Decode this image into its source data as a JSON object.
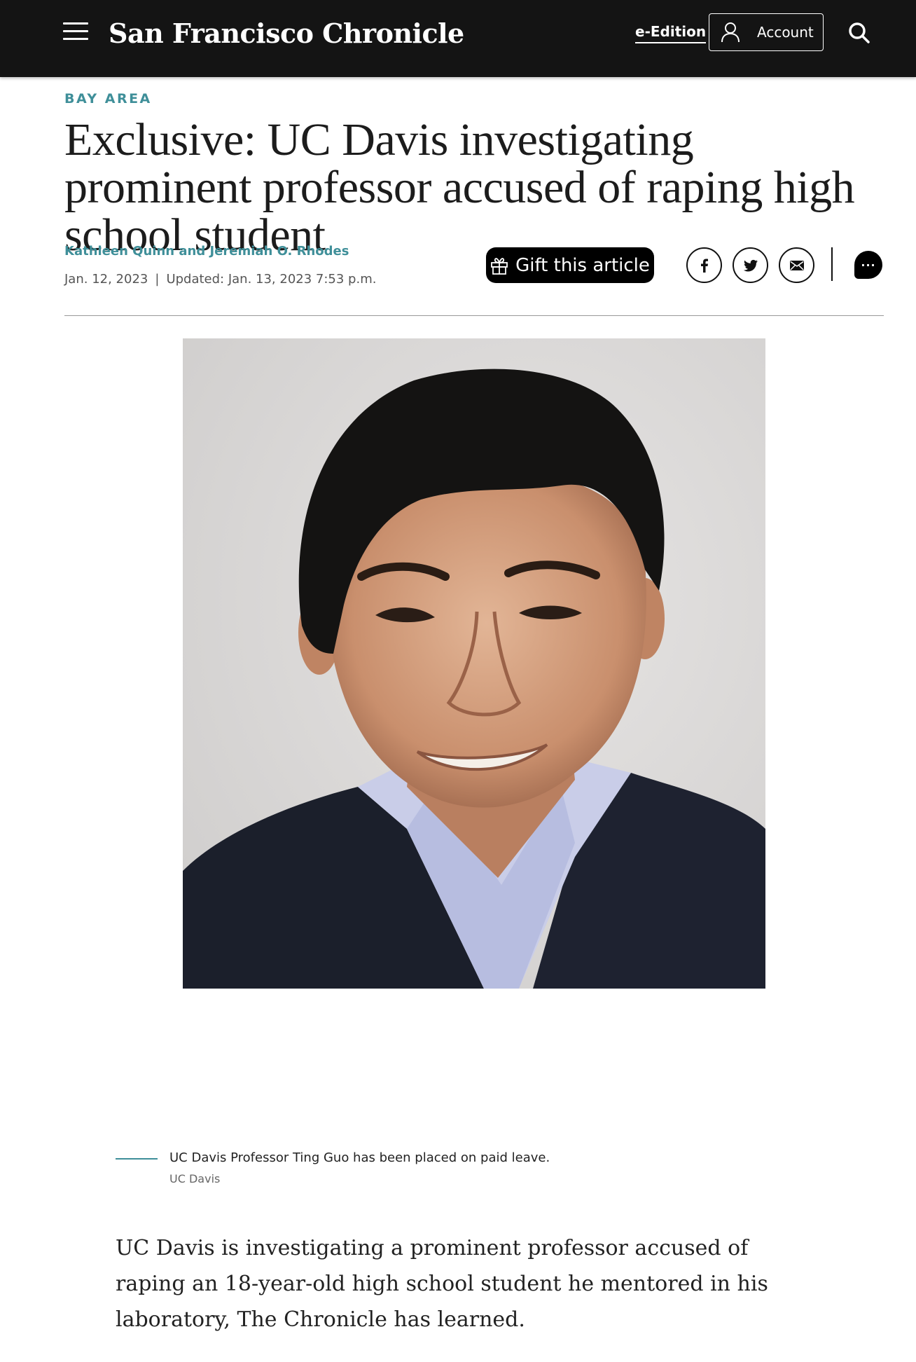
{
  "header": {
    "logo_text": "San Francisco Chronicle",
    "eedition_label": "e-Edition",
    "account_label": "Account",
    "icons": [
      "menu-icon",
      "user-icon",
      "search-icon"
    ]
  },
  "article": {
    "section": "BAY AREA",
    "headline": "Exclusive: UC Davis investigating prominent professor accused of raping high school student",
    "byline": "Kathleen Quinn and Jeremiah O. Rhodes",
    "date": "Jan. 12, 2023",
    "date_separator": "|",
    "updated": "Updated: Jan. 13, 2023 7:53 p.m.",
    "gift_label": "Gift this article",
    "share_icons": [
      "facebook-icon",
      "twitter-icon",
      "email-icon"
    ],
    "comment_label": "···",
    "photo": {
      "caption": "UC Davis Professor Ting Guo has been placed on paid leave.",
      "credit": "UC Davis"
    },
    "lede": "UC Davis is investigating a prominent professor accused of raping an 18-year-old high school student he mentored in his laboratory, The Chronicle has learned."
  },
  "colors": {
    "header_bg": "#141414",
    "accent_teal": "#3f8f99",
    "text": "#1c1c1c"
  }
}
